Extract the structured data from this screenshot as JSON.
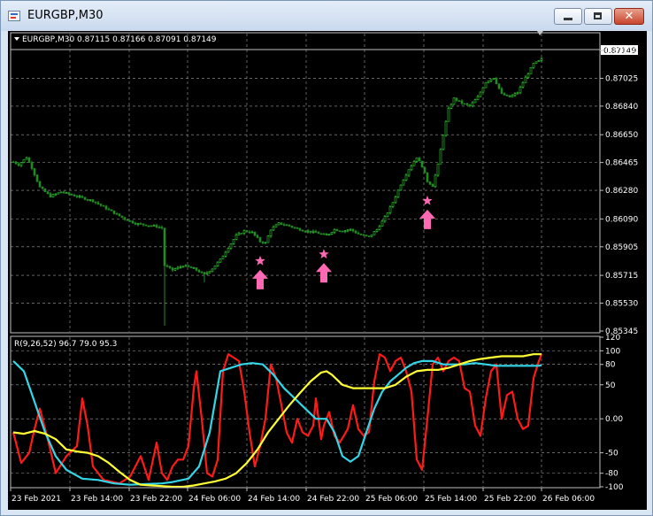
{
  "window": {
    "title": "EURGBP,M30",
    "buttons": {
      "minimize": "minimize",
      "maximize": "maximize",
      "close": "✕"
    }
  },
  "price_panel": {
    "header": "EURGBP,M30  0.87115 0.87166 0.87091 0.87149",
    "current_price": "0.87149",
    "ticks": [
      "0.87210",
      "0.87025",
      "0.86840",
      "0.86650",
      "0.86465",
      "0.86280",
      "0.86090",
      "0.85905",
      "0.85715",
      "0.85530",
      "0.85345"
    ]
  },
  "indicator_panel": {
    "header": "R(9,26,52) 96.7 79.0 95.3",
    "ticks": [
      "120",
      "100",
      "80",
      "50",
      "0.00",
      "-50",
      "-80",
      "-100"
    ]
  },
  "time_axis": [
    "23 Feb 2021",
    "23 Feb 14:00",
    "23 Feb 22:00",
    "24 Feb 06:00",
    "24 Feb 14:00",
    "24 Feb 22:00",
    "25 Feb 06:00",
    "25 Feb 14:00",
    "25 Feb 22:00",
    "26 Feb 06:00"
  ],
  "colors": {
    "background": "#000000",
    "grid": "#a0a0a0",
    "bull_candle": "#32cd32",
    "bear_candle": "#228b22",
    "signal": "#ff69b4",
    "line_red": "#ff1a1a",
    "line_cyan": "#33d6e6",
    "line_yellow": "#ffff33"
  },
  "chart_data": [
    {
      "type": "candlestick",
      "symbol": "EURGBP",
      "timeframe": "M30",
      "ohlc_last": {
        "open": 0.87115,
        "high": 0.87166,
        "low": 0.87091,
        "close": 0.87149
      },
      "ylim": [
        0.85345,
        0.8721
      ],
      "x_labels": [
        "23 Feb 2021",
        "23 Feb 14:00",
        "23 Feb 22:00",
        "24 Feb 06:00",
        "24 Feb 14:00",
        "24 Feb 22:00",
        "25 Feb 06:00",
        "25 Feb 14:00",
        "25 Feb 22:00",
        "26 Feb 06:00"
      ],
      "close_path": [
        [
          0,
          0.8647
        ],
        [
          2,
          0.8645
        ],
        [
          5,
          0.865
        ],
        [
          7,
          0.8643
        ],
        [
          10,
          0.863
        ],
        [
          14,
          0.8624
        ],
        [
          18,
          0.8627
        ],
        [
          22,
          0.8625
        ],
        [
          26,
          0.8623
        ],
        [
          30,
          0.8621
        ],
        [
          34,
          0.8617
        ],
        [
          38,
          0.8613
        ],
        [
          42,
          0.8609
        ],
        [
          46,
          0.8606
        ],
        [
          50,
          0.8605
        ],
        [
          54,
          0.8604
        ],
        [
          56,
          0.8603
        ],
        [
          57,
          0.8578
        ],
        [
          60,
          0.8575
        ],
        [
          64,
          0.8578
        ],
        [
          68,
          0.8576
        ],
        [
          72,
          0.8572
        ],
        [
          75,
          0.8576
        ],
        [
          78,
          0.8582
        ],
        [
          81,
          0.859
        ],
        [
          84,
          0.8598
        ],
        [
          87,
          0.8601
        ],
        [
          90,
          0.86
        ],
        [
          93,
          0.8594
        ],
        [
          95,
          0.8593
        ],
        [
          97,
          0.8602
        ],
        [
          100,
          0.8606
        ],
        [
          103,
          0.8605
        ],
        [
          106,
          0.8603
        ],
        [
          110,
          0.8601
        ],
        [
          114,
          0.86
        ],
        [
          118,
          0.8598
        ],
        [
          121,
          0.8602
        ],
        [
          124,
          0.8601
        ],
        [
          127,
          0.8602
        ],
        [
          130,
          0.8599
        ],
        [
          134,
          0.8597
        ],
        [
          137,
          0.8602
        ],
        [
          140,
          0.861
        ],
        [
          143,
          0.862
        ],
        [
          146,
          0.8632
        ],
        [
          149,
          0.8642
        ],
        [
          152,
          0.865
        ],
        [
          154,
          0.8644
        ],
        [
          156,
          0.8634
        ],
        [
          158,
          0.8631
        ],
        [
          160,
          0.8645
        ],
        [
          162,
          0.8665
        ],
        [
          164,
          0.8682
        ],
        [
          166,
          0.8689
        ],
        [
          169,
          0.8686
        ],
        [
          172,
          0.8684
        ],
        [
          175,
          0.869
        ],
        [
          178,
          0.87
        ],
        [
          181,
          0.8703
        ],
        [
          184,
          0.8692
        ],
        [
          187,
          0.869
        ],
        [
          190,
          0.8693
        ],
        [
          193,
          0.8703
        ],
        [
          196,
          0.8712
        ],
        [
          199,
          0.8715
        ]
      ],
      "signals": [
        {
          "type": "buy",
          "marker": "star+arrow",
          "x": 93
        },
        {
          "type": "buy",
          "marker": "star+arrow",
          "x": 117
        },
        {
          "type": "buy",
          "marker": "star+arrow",
          "x": 156
        }
      ]
    },
    {
      "type": "line",
      "name": "R(9,26,52)",
      "ylim": [
        -100,
        120
      ],
      "last_values": [
        96.7,
        79.0,
        95.3
      ],
      "series": [
        {
          "color": "red",
          "values": [
            [
              0,
              -20
            ],
            [
              3,
              -65
            ],
            [
              6,
              -50
            ],
            [
              8,
              -15
            ],
            [
              10,
              15
            ],
            [
              13,
              -30
            ],
            [
              16,
              -80
            ],
            [
              20,
              -55
            ],
            [
              24,
              -40
            ],
            [
              26,
              30
            ],
            [
              28,
              -10
            ],
            [
              30,
              -70
            ],
            [
              34,
              -90
            ],
            [
              40,
              -95
            ],
            [
              44,
              -85
            ],
            [
              48,
              -55
            ],
            [
              51,
              -90
            ],
            [
              54,
              -35
            ],
            [
              56,
              -80
            ],
            [
              58,
              -90
            ],
            [
              60,
              -70
            ],
            [
              62,
              -60
            ],
            [
              64,
              -60
            ],
            [
              66,
              -40
            ],
            [
              68,
              45
            ],
            [
              69,
              70
            ],
            [
              71,
              0
            ],
            [
              73,
              -80
            ],
            [
              75,
              -85
            ],
            [
              77,
              -60
            ],
            [
              79,
              70
            ],
            [
              81,
              95
            ],
            [
              83,
              90
            ],
            [
              85,
              85
            ],
            [
              87,
              40
            ],
            [
              89,
              -20
            ],
            [
              91,
              -70
            ],
            [
              93,
              -40
            ],
            [
              95,
              0
            ],
            [
              97,
              80
            ],
            [
              99,
              60
            ],
            [
              101,
              20
            ],
            [
              103,
              -20
            ],
            [
              105,
              -35
            ],
            [
              107,
              0
            ],
            [
              109,
              -20
            ],
            [
              111,
              -25
            ],
            [
              113,
              -10
            ],
            [
              114,
              30
            ],
            [
              115,
              0
            ],
            [
              116,
              -30
            ],
            [
              117,
              -10
            ],
            [
              119,
              10
            ],
            [
              121,
              -25
            ],
            [
              123,
              -35
            ],
            [
              126,
              -15
            ],
            [
              128,
              20
            ],
            [
              130,
              -15
            ],
            [
              132,
              -25
            ],
            [
              134,
              -20
            ],
            [
              136,
              55
            ],
            [
              138,
              95
            ],
            [
              140,
              90
            ],
            [
              142,
              70
            ],
            [
              144,
              85
            ],
            [
              146,
              90
            ],
            [
              148,
              70
            ],
            [
              150,
              40
            ],
            [
              152,
              -60
            ],
            [
              154,
              -75
            ],
            [
              156,
              0
            ],
            [
              158,
              80
            ],
            [
              160,
              90
            ],
            [
              162,
              70
            ],
            [
              164,
              85
            ],
            [
              166,
              90
            ],
            [
              168,
              85
            ],
            [
              170,
              45
            ],
            [
              172,
              40
            ],
            [
              174,
              -10
            ],
            [
              176,
              -25
            ],
            [
              178,
              30
            ],
            [
              180,
              70
            ],
            [
              182,
              80
            ],
            [
              184,
              0
            ],
            [
              186,
              35
            ],
            [
              188,
              40
            ],
            [
              190,
              0
            ],
            [
              192,
              -15
            ],
            [
              194,
              -10
            ],
            [
              196,
              60
            ],
            [
              198,
              85
            ],
            [
              199,
              95
            ]
          ]
        },
        {
          "color": "cyan",
          "values": [
            [
              0,
              85
            ],
            [
              4,
              70
            ],
            [
              8,
              25
            ],
            [
              12,
              -20
            ],
            [
              16,
              -55
            ],
            [
              20,
              -75
            ],
            [
              26,
              -88
            ],
            [
              32,
              -90
            ],
            [
              38,
              -95
            ],
            [
              44,
              -97
            ],
            [
              50,
              -96
            ],
            [
              56,
              -95
            ],
            [
              60,
              -93
            ],
            [
              66,
              -88
            ],
            [
              70,
              -70
            ],
            [
              74,
              -20
            ],
            [
              78,
              70
            ],
            [
              82,
              75
            ],
            [
              86,
              80
            ],
            [
              90,
              82
            ],
            [
              94,
              80
            ],
            [
              98,
              65
            ],
            [
              102,
              45
            ],
            [
              106,
              30
            ],
            [
              110,
              15
            ],
            [
              114,
              0
            ],
            [
              118,
              0
            ],
            [
              121,
              -20
            ],
            [
              124,
              -55
            ],
            [
              127,
              -63
            ],
            [
              130,
              -55
            ],
            [
              133,
              -20
            ],
            [
              136,
              15
            ],
            [
              139,
              40
            ],
            [
              142,
              55
            ],
            [
              145,
              65
            ],
            [
              148,
              75
            ],
            [
              151,
              82
            ],
            [
              154,
              85
            ],
            [
              158,
              85
            ],
            [
              162,
              80
            ],
            [
              166,
              80
            ],
            [
              170,
              80
            ],
            [
              174,
              82
            ],
            [
              178,
              80
            ],
            [
              182,
              78
            ],
            [
              186,
              78
            ],
            [
              190,
              78
            ],
            [
              194,
              78
            ],
            [
              198,
              78
            ],
            [
              199,
              79
            ]
          ]
        },
        {
          "color": "yellow",
          "values": [
            [
              0,
              -20
            ],
            [
              4,
              -22
            ],
            [
              8,
              -18
            ],
            [
              12,
              -22
            ],
            [
              16,
              -30
            ],
            [
              20,
              -45
            ],
            [
              24,
              -48
            ],
            [
              28,
              -50
            ],
            [
              32,
              -55
            ],
            [
              36,
              -65
            ],
            [
              40,
              -78
            ],
            [
              44,
              -90
            ],
            [
              48,
              -97
            ],
            [
              52,
              -98
            ],
            [
              56,
              -99
            ],
            [
              60,
              -100
            ],
            [
              64,
              -100
            ],
            [
              68,
              -98
            ],
            [
              72,
              -95
            ],
            [
              76,
              -92
            ],
            [
              80,
              -88
            ],
            [
              84,
              -80
            ],
            [
              88,
              -65
            ],
            [
              92,
              -45
            ],
            [
              96,
              -20
            ],
            [
              100,
              0
            ],
            [
              104,
              20
            ],
            [
              108,
              38
            ],
            [
              112,
              55
            ],
            [
              116,
              68
            ],
            [
              118,
              70
            ],
            [
              120,
              65
            ],
            [
              124,
              50
            ],
            [
              128,
              45
            ],
            [
              132,
              45
            ],
            [
              136,
              45
            ],
            [
              140,
              45
            ],
            [
              144,
              50
            ],
            [
              148,
              62
            ],
            [
              152,
              70
            ],
            [
              156,
              72
            ],
            [
              160,
              72
            ],
            [
              164,
              75
            ],
            [
              168,
              80
            ],
            [
              172,
              85
            ],
            [
              176,
              88
            ],
            [
              180,
              90
            ],
            [
              184,
              92
            ],
            [
              188,
              92
            ],
            [
              192,
              92
            ],
            [
              196,
              95
            ],
            [
              199,
              95
            ]
          ]
        }
      ]
    }
  ]
}
